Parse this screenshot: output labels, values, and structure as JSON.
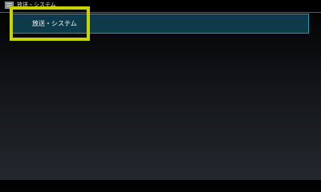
{
  "window": {
    "title": "放送・システム",
    "icon": "settings-menu-icon"
  },
  "menu": {
    "items": [
      {
        "label": "放送・システム",
        "selected": true
      }
    ]
  },
  "colors": {
    "focus_highlight": "#c8d400",
    "item_background": "#0d3b4a",
    "item_border": "#3b8fa6"
  }
}
